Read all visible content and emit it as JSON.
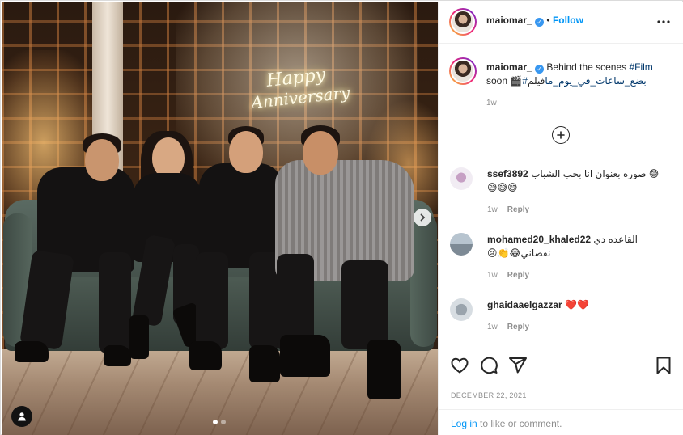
{
  "photo": {
    "neon_sign": {
      "line1": "Happy",
      "line2": "Anniversary"
    },
    "carousel": {
      "count": 2,
      "active_index": 0
    },
    "next_icon": "chevron-right-icon",
    "tag_icon": "user-tag-icon"
  },
  "header": {
    "username": "maiomar_",
    "verified": "✓",
    "separator": "•",
    "follow_label": "Follow",
    "more_icon": "more-horizontal-icon"
  },
  "caption": {
    "username": "maiomar_",
    "verified": "✓",
    "text_prefix": "Behind the scenes ",
    "hashtag_en": "#Film",
    "line2_a": "فيلم ",
    "hashtag_ar": "#بضع_ساعات_في_يوم_ما",
    "line2_b": " soon 🎬",
    "time": "1w"
  },
  "load_more_icon": "plus-circle-icon",
  "comments": [
    {
      "username": "ssef3892",
      "text": "صوره بعنوان انا بحب الشباب 😅",
      "text2": "😅😅😅",
      "time": "1w",
      "reply": "Reply"
    },
    {
      "username": "mohamed20_khaled22",
      "text": "القاعده دي",
      "text2": "😢👏😂نقصاني",
      "time": "1w",
      "reply": "Reply"
    },
    {
      "username": "ghaidaaelgazzar",
      "text": "❤️❤️",
      "time": "1w",
      "reply": "Reply"
    }
  ],
  "actions": {
    "like_icon": "heart-icon",
    "comment_icon": "comment-icon",
    "share_icon": "share-icon",
    "save_icon": "bookmark-icon"
  },
  "date": "DECEMBER 22, 2021",
  "login": {
    "link": "Log in",
    "rest": " to like or comment."
  }
}
